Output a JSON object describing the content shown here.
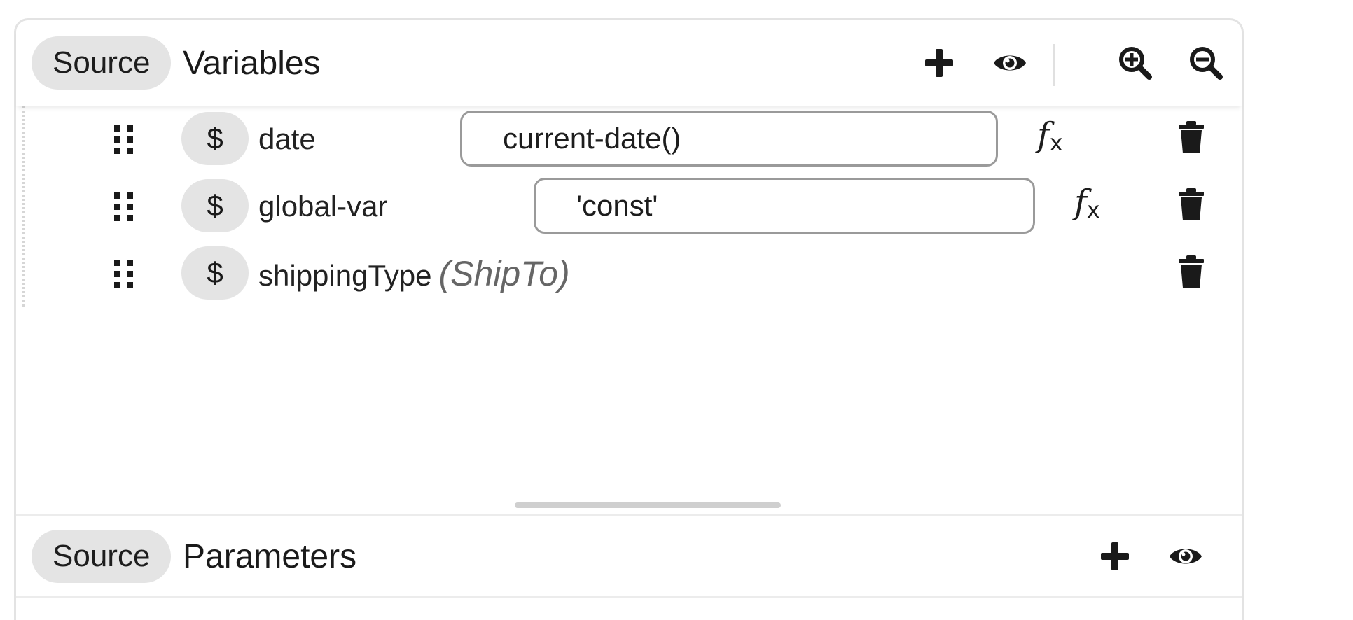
{
  "variables_section": {
    "source_label": "Source",
    "title": "Variables",
    "actions": {
      "add_icon": "plus-icon",
      "view_icon": "eye-icon",
      "zoom_in_icon": "zoom-in-icon",
      "zoom_out_icon": "zoom-out-icon"
    },
    "rows": [
      {
        "prefix": "$",
        "name": "date",
        "type": "",
        "expression": "current-date()",
        "fx_label": "f",
        "fx_sub": "x"
      },
      {
        "prefix": "$",
        "name": "global-var",
        "type": "",
        "expression": "'const'",
        "fx_label": "f",
        "fx_sub": "x"
      },
      {
        "prefix": "$",
        "name": "shippingType",
        "type": "(ShipTo)"
      }
    ]
  },
  "parameters_section": {
    "source_label": "Source",
    "title": "Parameters",
    "actions": {
      "add_icon": "plus-icon",
      "view_icon": "eye-icon"
    }
  },
  "colors": {
    "pill_background": "#e4e4e4",
    "border": "#e3e3e3",
    "input_border": "#9a9a9a",
    "icon": "#1a1a1a"
  }
}
